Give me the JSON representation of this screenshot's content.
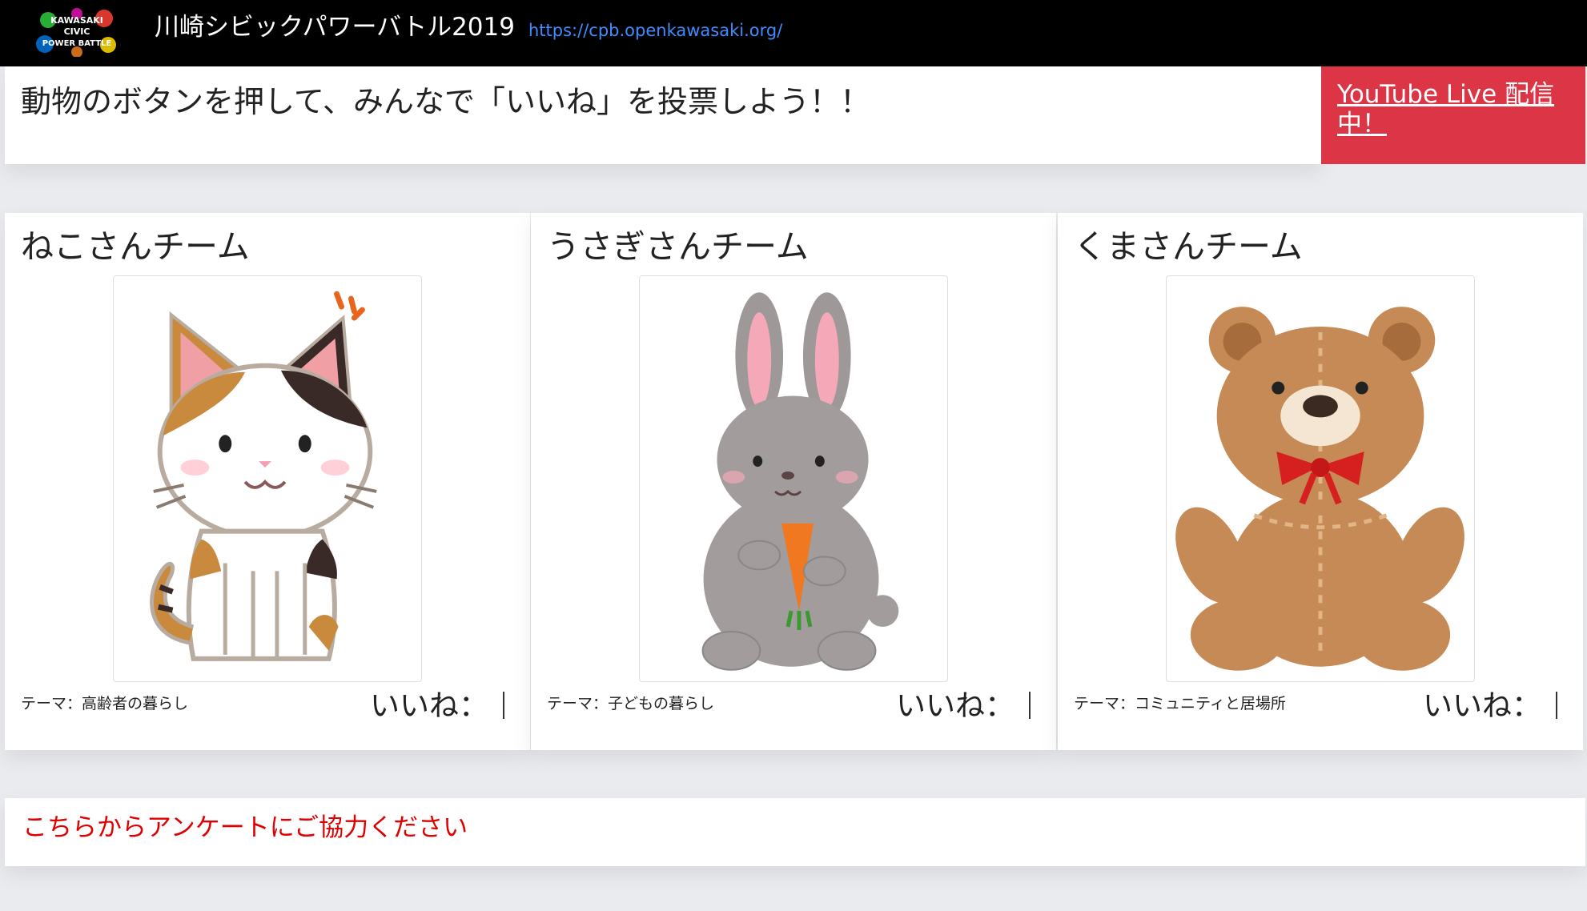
{
  "header": {
    "logo_text": [
      "KAWASAKI",
      "CIVIC",
      "POWER BATTLE"
    ],
    "title": "川崎シビックパワーバトル2019",
    "url": "https://cpb.openkawasaki.org/"
  },
  "banner": {
    "message": "動物のボタンを押して、みんなで「いいね」を投票しよう！！",
    "live_label": "YouTube Live 配信中！",
    "live_color": "#dc3545"
  },
  "teams": [
    {
      "name": "ねこさんチーム",
      "theme": "テーマ：高齢者の暮らし",
      "like_label": "いいね：",
      "icon": "cat-illustration"
    },
    {
      "name": "うさぎさんチーム",
      "theme": "テーマ：子どもの暮らし",
      "like_label": "いいね：",
      "icon": "rabbit-illustration"
    },
    {
      "name": "くまさんチーム",
      "theme": "テーマ：コミュニティと居場所",
      "like_label": "いいね：",
      "icon": "bear-illustration"
    }
  ],
  "survey": {
    "label": "こちらからアンケートにご協力ください",
    "color": "#e00000"
  }
}
